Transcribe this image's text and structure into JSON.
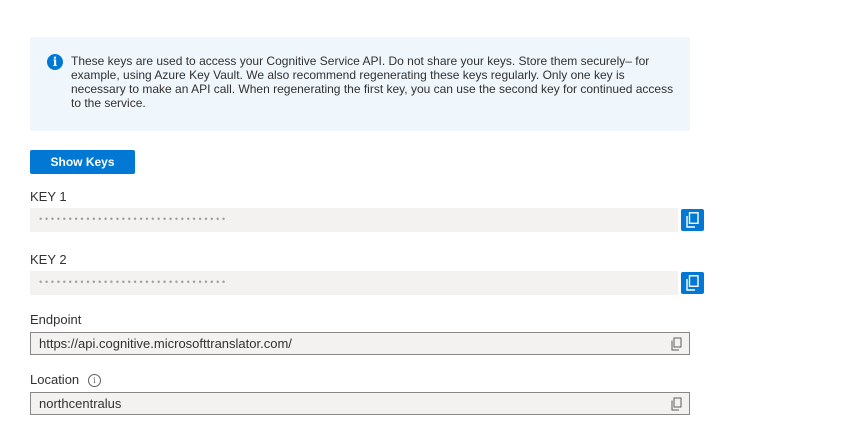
{
  "info": {
    "icon": "info-icon",
    "text": "These keys are used to access your Cognitive Service API. Do not share your keys. Store them securely– for example, using Azure Key Vault. We also recommend regenerating these keys regularly. Only one key is necessary to make an API call. When regenerating the first key, you can use the second key for continued access to the service."
  },
  "show_keys_label": "Show Keys",
  "key1": {
    "label": "KEY 1",
    "value": "••••••••••••••••••••••••••••••••",
    "copy_icon": "copy-icon"
  },
  "key2": {
    "label": "KEY 2",
    "value": "••••••••••••••••••••••••••••••••",
    "copy_icon": "copy-icon"
  },
  "endpoint": {
    "label": "Endpoint",
    "value": "https://api.cognitive.microsofttranslator.com/",
    "copy_icon": "copy-icon"
  },
  "location": {
    "label": "Location",
    "value": "northcentralus",
    "info_icon": "info-circle-icon",
    "copy_icon": "copy-icon"
  },
  "colors": {
    "accent": "#0078d4",
    "info_bg": "#eff6fc",
    "field_bg": "#f3f2f1",
    "text": "#323130"
  }
}
